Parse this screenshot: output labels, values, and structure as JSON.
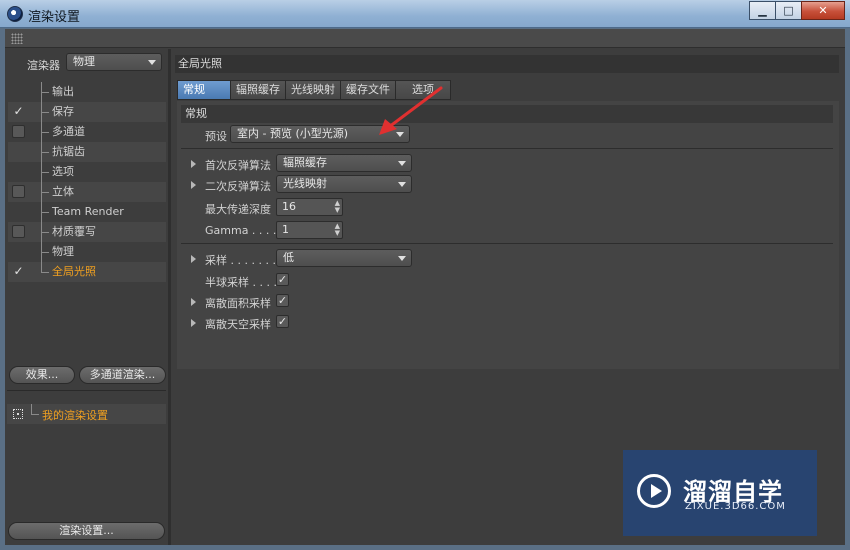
{
  "window": {
    "title": "渲染设置",
    "buttons": {
      "minimize": "▁",
      "maximize": "□",
      "close": "✕"
    }
  },
  "left": {
    "renderer_label": "渲染器",
    "renderer_value": "物理",
    "tree": [
      {
        "label": "输出",
        "check": "none"
      },
      {
        "label": "保存",
        "check": "tick"
      },
      {
        "label": "多通道",
        "check": "box"
      },
      {
        "label": "抗锯齿",
        "check": "none"
      },
      {
        "label": "选项",
        "check": "none"
      },
      {
        "label": "立体",
        "check": "box"
      },
      {
        "label": "Team Render",
        "check": "none"
      },
      {
        "label": "材质覆写",
        "check": "box"
      },
      {
        "label": "物理",
        "check": "none"
      },
      {
        "label": "全局光照",
        "check": "tick",
        "active": true
      }
    ],
    "effects_button": "效果...",
    "multipass_button": "多通道渲染...",
    "my_settings": "我的渲染设置",
    "render_settings_button": "渲染设置..."
  },
  "right": {
    "panel_title": "全局光照",
    "tabs": [
      "常规",
      "辐照缓存",
      "光线映射",
      "缓存文件",
      "选项"
    ],
    "section": "常规",
    "preset_label": "预设",
    "preset_value": "室内 - 预览 (小型光源)",
    "primary_label": "首次反弹算法",
    "primary_value": "辐照缓存",
    "secondary_label": "二次反弹算法",
    "secondary_value": "光线映射",
    "depth_label": "最大传递深度",
    "depth_value": "16",
    "gamma_label": "Gamma . . . .",
    "gamma_value": "1",
    "samples_label": "采样 . . . . . . .",
    "samples_value": "低",
    "hemi_label": "半球采样 . . . .",
    "discrete_area_label": "离散面积采样",
    "discrete_sky_label": "离散天空采样",
    "check_mark": "✓"
  },
  "annotation_color": "#e03030",
  "watermark": {
    "brand": "溜溜自学",
    "site": "ZIXUE.3D66.COM"
  }
}
